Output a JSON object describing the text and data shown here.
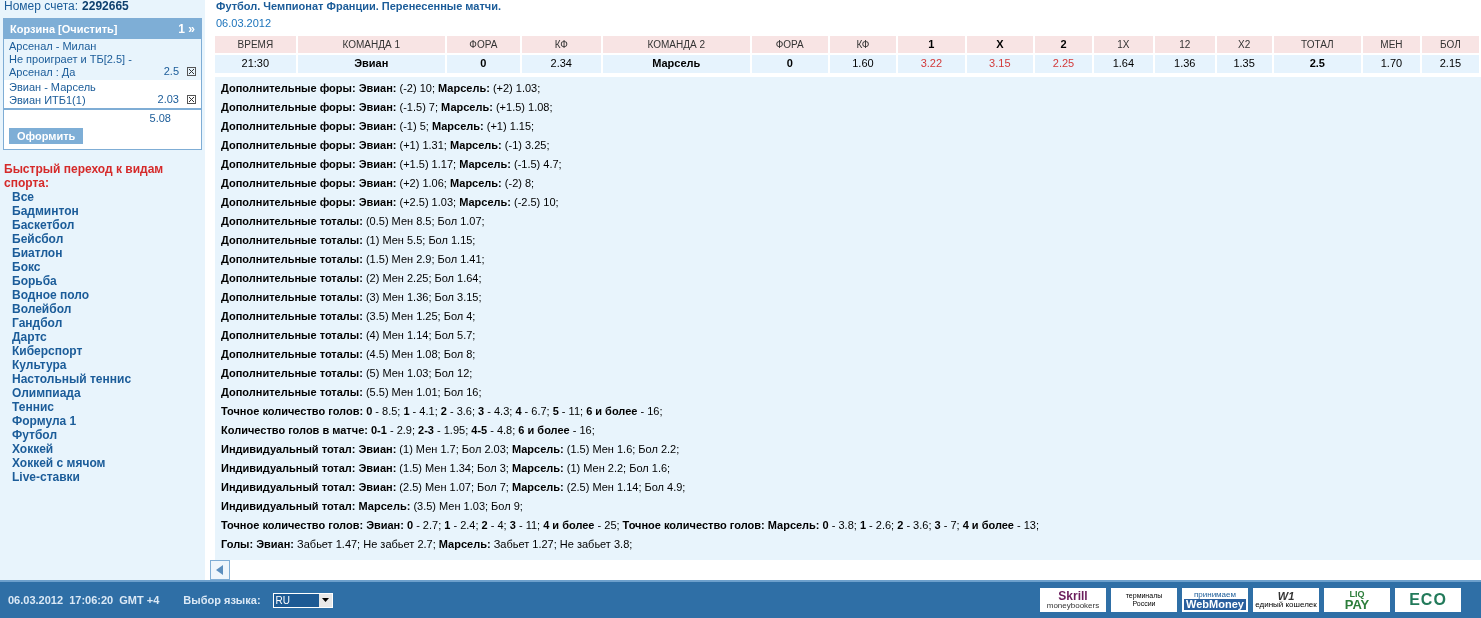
{
  "account": {
    "label": "Номер счета:",
    "value": "2292665"
  },
  "basket": {
    "title": "Корзина [Очистить]",
    "count": "1 »",
    "bets": [
      {
        "match": "Арсенал - Милан",
        "bet": "Не проиграет и ТБ[2.5] - Арсенал : Да",
        "odds": "2.5",
        "highlighted": true
      },
      {
        "match": "Эвиан - Марсель",
        "bet": "Эвиан ИТБ1(1)",
        "odds": "2.03",
        "highlighted": false
      }
    ],
    "total": "5.08",
    "submit": "Оформить"
  },
  "sports": {
    "title": "Быстрый переход к видам спорта:",
    "items": [
      "Все",
      "Бадминтон",
      "Баскетбол",
      "Бейсбол",
      "Биатлон",
      "Бокс",
      "Борьба",
      "Водное поло",
      "Волейбол",
      "Гандбол",
      "Дартс",
      "Киберспорт",
      "Культура",
      "Настольный теннис",
      "Олимпиада",
      "Теннис",
      "Формула 1",
      "Футбол",
      "Хоккей",
      "Хоккей с мячом",
      "Live-ставки"
    ]
  },
  "event": {
    "title": "Футбол. Чемпионат Франции. Перенесенные матчи.",
    "date": "06.03.2012"
  },
  "table": {
    "columns": [
      {
        "label": "ВРЕМЯ",
        "bold": false
      },
      {
        "label": "КОМАНДА 1",
        "bold": false
      },
      {
        "label": "ФОРА",
        "bold": false
      },
      {
        "label": "КФ",
        "bold": false
      },
      {
        "label": "КОМАНДА 2",
        "bold": false
      },
      {
        "label": "ФОРА",
        "bold": false
      },
      {
        "label": "КФ",
        "bold": false
      },
      {
        "label": "1",
        "bold": true
      },
      {
        "label": "X",
        "bold": true
      },
      {
        "label": "2",
        "bold": true
      },
      {
        "label": "1X",
        "bold": false
      },
      {
        "label": "12",
        "bold": false
      },
      {
        "label": "X2",
        "bold": false
      },
      {
        "label": "ТОТАЛ",
        "bold": false
      },
      {
        "label": "МЕН",
        "bold": false
      },
      {
        "label": "БОЛ",
        "bold": false
      }
    ],
    "rows": [
      [
        {
          "text": "21:30",
          "kind": "plain"
        },
        {
          "text": "Эвиан",
          "kind": "bold"
        },
        {
          "text": "0",
          "kind": "bold"
        },
        {
          "text": "2.34",
          "kind": "plain"
        },
        {
          "text": "Марсель",
          "kind": "bold"
        },
        {
          "text": "0",
          "kind": "bold"
        },
        {
          "text": "1.60",
          "kind": "plain"
        },
        {
          "text": "3.22",
          "kind": "red"
        },
        {
          "text": "3.15",
          "kind": "red"
        },
        {
          "text": "2.25",
          "kind": "red"
        },
        {
          "text": "1.64",
          "kind": "plain"
        },
        {
          "text": "1.36",
          "kind": "plain"
        },
        {
          "text": "1.35",
          "kind": "plain"
        },
        {
          "text": "2.5",
          "kind": "bold"
        },
        {
          "text": "1.70",
          "kind": "plain"
        },
        {
          "text": "2.15",
          "kind": "plain"
        }
      ]
    ]
  },
  "markets": [
    "**Дополнительные форы: Эвиан:** (-2) 10; **Марсель:** (+2) 1.03;",
    "**Дополнительные форы: Эвиан:** (-1.5) 7; **Марсель:** (+1.5) 1.08;",
    "**Дополнительные форы: Эвиан:** (-1) 5; **Марсель:** (+1) 1.15;",
    "**Дополнительные форы: Эвиан:** (+1) 1.31; **Марсель:** (-1) 3.25;",
    "**Дополнительные форы: Эвиан:** (+1.5) 1.17; **Марсель:** (-1.5) 4.7;",
    "**Дополнительные форы: Эвиан:** (+2) 1.06; **Марсель:** (-2) 8;",
    "**Дополнительные форы: Эвиан:** (+2.5) 1.03; **Марсель:** (-2.5) 10;",
    "**Дополнительные тоталы:** (0.5) Мен 8.5; Бол 1.07;",
    "**Дополнительные тоталы:** (1) Мен 5.5; Бол 1.15;",
    "**Дополнительные тоталы:** (1.5) Мен 2.9; Бол 1.41;",
    "**Дополнительные тоталы:** (2) Мен 2.25; Бол 1.64;",
    "**Дополнительные тоталы:** (3) Мен 1.36; Бол 3.15;",
    "**Дополнительные тоталы:** (3.5) Мен 1.25; Бол 4;",
    "**Дополнительные тоталы:** (4) Мен 1.14; Бол 5.7;",
    "**Дополнительные тоталы:** (4.5) Мен 1.08; Бол 8;",
    "**Дополнительные тоталы:** (5) Мен 1.03; Бол 12;",
    "**Дополнительные тоталы:** (5.5) Мен 1.01; Бол 16;",
    "**Точное количество голов: 0** - 8.5; **1** - 4.1; **2** - 3.6; **3** - 4.3; **4** - 6.7; **5** - 11; **6 и более** - 16;",
    "**Количество голов в матче: 0-1** - 2.9; **2-3** - 1.95; **4-5** - 4.8; **6 и более** - 16;",
    "**Индивидуальный тотал: Эвиан:** (1) Мен 1.7; Бол 2.03; **Марсель:** (1.5) Мен 1.6; Бол 2.2;",
    "**Индивидуальный тотал: Эвиан:** (1.5) Мен 1.34; Бол 3; **Марсель:** (1) Мен 2.2; Бол 1.6;",
    "**Индивидуальный тотал: Эвиан:** (2.5) Мен 1.07; Бол 7; **Марсель:** (2.5) Мен 1.14; Бол 4.9;",
    "**Индивидуальный тотал: Марсель:** (3.5) Мен 1.03; Бол 9;",
    "**Точное количество голов: Эвиан: 0** - 2.7; **1** - 2.4; **2** - 4; **3** - 11; **4 и более** - 25; **Точное количество голов: Марсель: 0** - 3.8; **1** - 2.6; **2** - 3.6; **3** - 7; **4 и более** - 13;",
    "**Голы: Эвиан:** Забьет 1.47; Не забьет 2.7; **Марсель:** Забьет 1.27; Не забьет 3.8;"
  ],
  "footer": {
    "datetime": "06.03.2012  17:06:20  GMT +4",
    "language_label": "Выбор языка:",
    "language": "RU",
    "payments": [
      {
        "kind": "skrill",
        "lines": [
          "Skrill",
          "moneybookers"
        ]
      },
      {
        "kind": "terminals",
        "lines": [
          "терминалы",
          "России"
        ]
      },
      {
        "kind": "webmoney",
        "lines": [
          "принимаем",
          "WebMoney"
        ]
      },
      {
        "kind": "wallet",
        "lines": [
          "W1",
          "единый кошелек"
        ]
      },
      {
        "kind": "liqpay",
        "lines": [
          "LIQ",
          "PAY"
        ]
      },
      {
        "kind": "eco",
        "lines": [
          "ECO"
        ]
      }
    ]
  }
}
